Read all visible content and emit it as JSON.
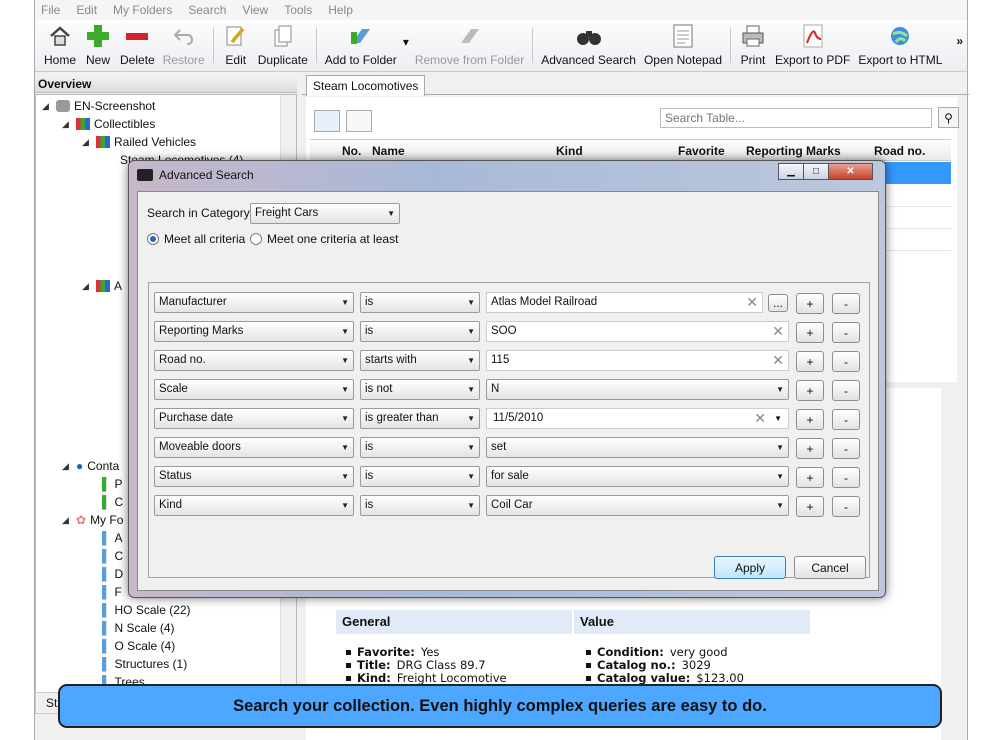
{
  "menu": [
    "File",
    "Edit",
    "My Folders",
    "Search",
    "View",
    "Tools",
    "Help"
  ],
  "toolbar": {
    "home": "Home",
    "new": "New",
    "delete": "Delete",
    "restore": "Restore",
    "edit": "Edit",
    "duplicate": "Duplicate",
    "add_to_folder": "Add to Folder",
    "remove_from_folder": "Remove from Folder",
    "advanced_search": "Advanced Search",
    "open_notepad": "Open Notepad",
    "print": "Print",
    "export_pdf": "Export to PDF",
    "export_html": "Export to HTML",
    "overflow": "»"
  },
  "sidebar": {
    "title": "Overview",
    "tree": {
      "root": "EN-Screenshot",
      "collectibles": "Collectibles",
      "railed": "Railed Vehicles",
      "steam": "Steam Locomotives (4)",
      "a": "A",
      "contacts": "Conta",
      "p": "P",
      "c": "C",
      "myfolders": "My Fo",
      "f1": "A",
      "f2": "C",
      "f3": "D",
      "f4": "F",
      "ho": "HO Scale (22)",
      "n": "N Scale (4)",
      "o": "O Scale (4)",
      "structures": "Structures (1)",
      "trees": "Trees"
    },
    "status": "Sta"
  },
  "main": {
    "tab": "Steam Locomotives",
    "search_placeholder": "Search Table...",
    "columns": [
      "No.",
      "Name",
      "Kind",
      "Favorite",
      "Reporting Marks",
      "Road no."
    ],
    "selected_row": {
      "name": "DRG Class 89.7",
      "kind": "Freight Locomotive"
    }
  },
  "details": {
    "general_header": "General",
    "value_header": "Value",
    "general": [
      {
        "k": "Favorite:",
        "v": "Yes"
      },
      {
        "k": "Title:",
        "v": "DRG Class 89.7"
      },
      {
        "k": "Kind:",
        "v": "Freight Locomotive"
      }
    ],
    "value": [
      {
        "k": "Condition:",
        "v": "very good"
      },
      {
        "k": "Catalog no.:",
        "v": "3029"
      },
      {
        "k": "Catalog value:",
        "v": "$123.00"
      }
    ]
  },
  "dialog": {
    "title": "Advanced Search",
    "category_label": "Search in Category:",
    "category_value": "Freight Cars",
    "radio_all": "Meet all criteria",
    "radio_one": "Meet one criteria at least",
    "criteria": [
      {
        "field": "Manufacturer",
        "op": "is",
        "value": "Atlas Model Railroad",
        "type": "text-browse"
      },
      {
        "field": "Reporting Marks",
        "op": "is",
        "value": "SOO",
        "type": "text"
      },
      {
        "field": "Road no.",
        "op": "starts with",
        "value": "115",
        "type": "text"
      },
      {
        "field": "Scale",
        "op": "is not",
        "value": "N",
        "type": "select"
      },
      {
        "field": "Purchase date",
        "op": "is greater than",
        "value": "11/5/2010",
        "type": "date"
      },
      {
        "field": "Moveable doors",
        "op": "is",
        "value": "set",
        "type": "select"
      },
      {
        "field": "Status",
        "op": "is",
        "value": "for sale",
        "type": "select"
      },
      {
        "field": "Kind",
        "op": "is",
        "value": "Coil Car",
        "type": "select"
      }
    ],
    "browse": "...",
    "plus": "+",
    "minus": "-",
    "apply": "Apply",
    "cancel": "Cancel"
  },
  "banner": "Search your collection. Even highly complex queries are easy to do."
}
